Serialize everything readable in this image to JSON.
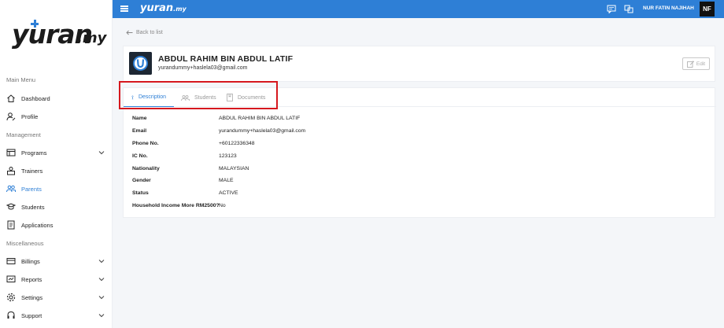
{
  "brand": {
    "name": "yuran",
    "suffix": ".my"
  },
  "sidebar": {
    "sections": [
      {
        "label": "Main Menu"
      },
      {
        "label": "Management"
      },
      {
        "label": "Miscellaneous"
      }
    ],
    "items": [
      {
        "label": "Dashboard",
        "icon": "home-icon"
      },
      {
        "label": "Profile",
        "icon": "profile-icon"
      },
      {
        "label": "Programs",
        "icon": "programs-icon",
        "expandable": true
      },
      {
        "label": "Trainers",
        "icon": "trainers-icon"
      },
      {
        "label": "Parents",
        "icon": "parents-icon",
        "active": true
      },
      {
        "label": "Students",
        "icon": "students-icon"
      },
      {
        "label": "Applications",
        "icon": "applications-icon"
      },
      {
        "label": "Billings",
        "icon": "billings-icon",
        "expandable": true
      },
      {
        "label": "Reports",
        "icon": "reports-icon",
        "expandable": true
      },
      {
        "label": "Settings",
        "icon": "settings-icon",
        "expandable": true
      },
      {
        "label": "Support",
        "icon": "support-icon",
        "expandable": true
      }
    ]
  },
  "topbar": {
    "brand": "yuran",
    "brand_suffix": ".my",
    "user_name": "NUR FATIN NAJIHAH",
    "user_initials": "NF",
    "color": "#2e7fd6"
  },
  "back_link": "Back to list",
  "profile": {
    "name": "ABDUL RAHIM BIN ABDUL LATIF",
    "email": "yurandummy+haslela03@gmail.com",
    "edit_label": "Edit"
  },
  "tabs": [
    {
      "label": "Description",
      "icon": "description-icon",
      "active": true
    },
    {
      "label": "Students",
      "icon": "students-tab-icon"
    },
    {
      "label": "Documents",
      "icon": "documents-icon"
    }
  ],
  "details": [
    {
      "label": "Name",
      "value": "ABDUL RAHIM BIN ABDUL LATIF"
    },
    {
      "label": "Email",
      "value": "yurandummy+haslela03@gmail.com"
    },
    {
      "label": "Phone No.",
      "value": "+60122336348"
    },
    {
      "label": "IC No.",
      "value": "123123"
    },
    {
      "label": "Nationality",
      "value": "MALAYSIAN"
    },
    {
      "label": "Gender",
      "value": "MALE"
    },
    {
      "label": "Status",
      "value": "ACTIVE"
    },
    {
      "label": "Household Income More RM2500?",
      "value": "No"
    }
  ],
  "colors": {
    "accent": "#2e7fd6",
    "highlight": "#d6181e"
  }
}
